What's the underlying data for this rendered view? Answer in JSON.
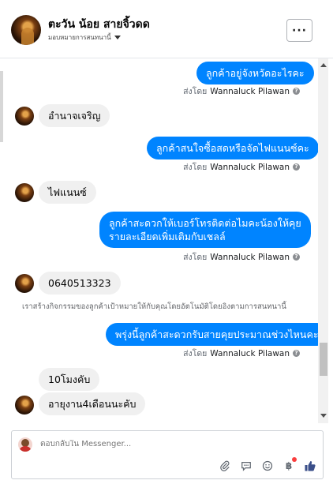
{
  "header": {
    "page_name": "ตะวัน น้อย สายจิ้วดด",
    "assign_label": "มอบหมายการสนทนานี้",
    "more_label": "···"
  },
  "messages": [
    {
      "id": "m1",
      "type": "out",
      "text": "ลูกค้าอยู่จังหวัดอะไรคะ",
      "sent_prefix": "ส่งโดย",
      "sender": "Wannaluck Pilawan"
    },
    {
      "id": "m2",
      "type": "in",
      "text": "อำนาจเจริญ"
    },
    {
      "id": "m3",
      "type": "out",
      "text": "ลูกค้าสนใจซื้อสดหรือจัดไฟแนนซ์คะ",
      "sent_prefix": "ส่งโดย",
      "sender": "Wannaluck Pilawan"
    },
    {
      "id": "m4",
      "type": "in",
      "text": "ไฟแนนซ์"
    },
    {
      "id": "m5",
      "type": "out",
      "lines": [
        "ลูกค้าสะดวกให้เบอร์โทรติดต่อไมคะน้องให้คุย",
        "รายละเอียดเพิ่มเติมกับเชลล์"
      ],
      "sent_prefix": "ส่งโดย",
      "sender": "Wannaluck Pilawan"
    },
    {
      "id": "m6",
      "type": "in",
      "text": "0640513323"
    },
    {
      "id": "note",
      "type": "note",
      "text": "เราสร้างกิจกรรมของลูกค้าเป้าหมายให้กับคุณโดยอัตโนมัติโดยอิงตามการสนทนานี้"
    },
    {
      "id": "m7",
      "type": "out",
      "text": "พรุ่งนี้ลูกค้าสะดวกรับสายคุยประมาณช่วงไหนคะ",
      "sent_prefix": "ส่งโดย",
      "sender": "Wannaluck Pilawan"
    },
    {
      "id": "m8",
      "type": "in",
      "text": "10โมงคับ"
    },
    {
      "id": "m9",
      "type": "in",
      "text": "อายุงาน4เดือนนะคับ"
    }
  ],
  "composer": {
    "placeholder": "ตอบกลับใน Messenger...",
    "tools": [
      "attachment-icon",
      "saved-reply-icon",
      "emoji-icon",
      "baht-payment-icon",
      "like-icon"
    ]
  },
  "colors": {
    "outgoing_bubble": "#0084ff",
    "incoming_bubble": "#f0f0f0",
    "notification_dot": "#fa3e3e"
  }
}
